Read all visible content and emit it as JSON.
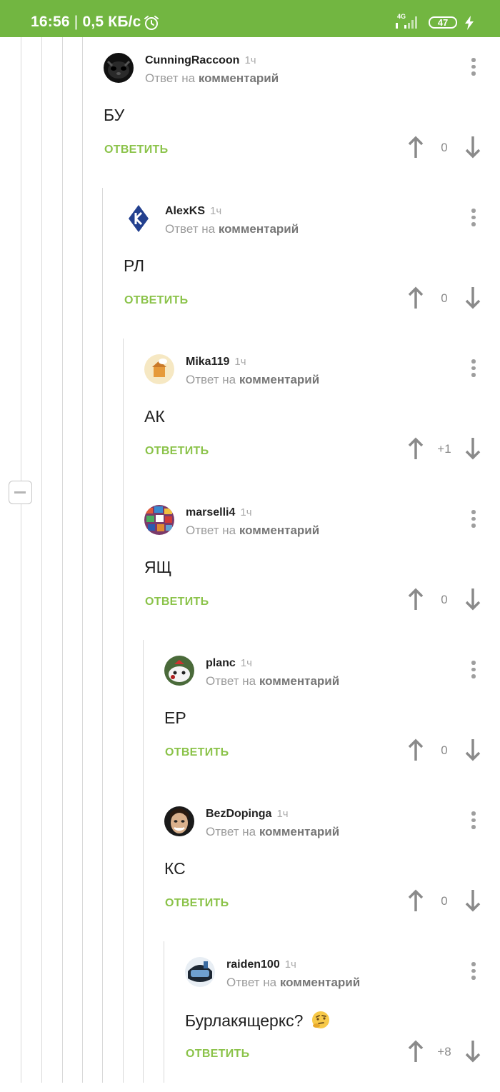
{
  "status_bar": {
    "time": "16:56",
    "separator": "|",
    "speed": "0,5 КБ/с",
    "network": "4G",
    "battery": "47",
    "background": "#72b641"
  },
  "icons": {
    "alarm": "alarm-clock-icon",
    "signal": "signal-bars-icon",
    "battery": "battery-icon",
    "charging": "lightning-bolt-icon",
    "collapse": "minus-icon",
    "menu": "more-vertical-icon",
    "upvote": "arrow-up-icon",
    "downvote": "arrow-down-icon"
  },
  "colors": {
    "accent_green": "#8bc34a",
    "status_green": "#72b641",
    "thread_line": "#d9d9d9"
  },
  "comments": [
    {
      "user": "CunningRaccoon",
      "time": "1ч",
      "reply_prefix": "Ответ на",
      "reply_target": "комментарий",
      "text": "БУ",
      "answer": "ОТВЕТИТЬ",
      "votes": "0"
    },
    {
      "user": "AlexKS",
      "time": "1ч",
      "reply_prefix": "Ответ на",
      "reply_target": "комментарий",
      "text": "РЛ",
      "answer": "ОТВЕТИТЬ",
      "votes": "0"
    },
    {
      "user": "Mika119",
      "time": "1ч",
      "reply_prefix": "Ответ на",
      "reply_target": "комментарий",
      "text": "АК",
      "answer": "ОТВЕТИТЬ",
      "votes": "+1"
    },
    {
      "user": "marselli4",
      "time": "1ч",
      "reply_prefix": "Ответ на",
      "reply_target": "комментарий",
      "text": "ЯЩ",
      "answer": "ОТВЕТИТЬ",
      "votes": "0"
    },
    {
      "user": "planc",
      "time": "1ч",
      "reply_prefix": "Ответ на",
      "reply_target": "комментарий",
      "text": "ЕР",
      "answer": "ОТВЕТИТЬ",
      "votes": "0"
    },
    {
      "user": "BezDopinga",
      "time": "1ч",
      "reply_prefix": "Ответ на",
      "reply_target": "комментарий",
      "text": "КС",
      "answer": "ОТВЕТИТЬ",
      "votes": "0"
    },
    {
      "user": "raiden100",
      "time": "1ч",
      "reply_prefix": "Ответ на",
      "reply_target": "комментарий",
      "text": "Бурлакящеркс?",
      "emoji": "thinking-face-emoji",
      "answer": "ОТВЕТИТЬ",
      "votes": "+8"
    }
  ]
}
